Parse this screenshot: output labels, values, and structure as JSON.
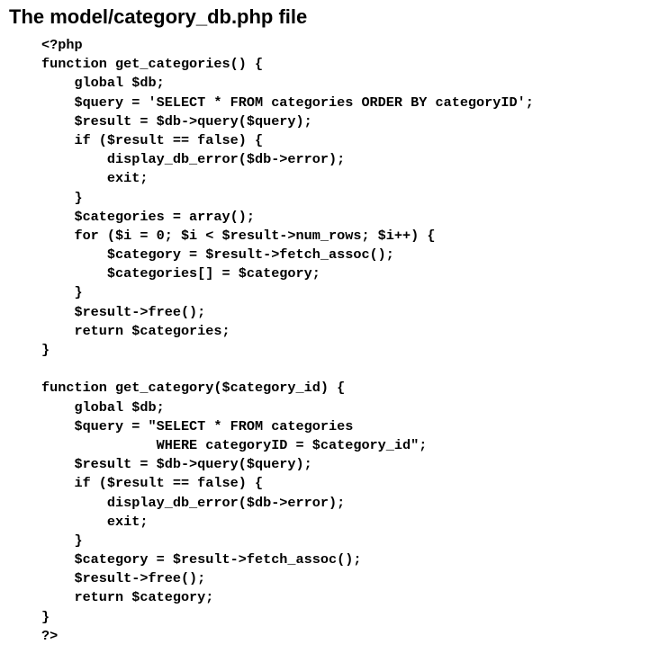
{
  "document": {
    "title": "The model/category_db.php file",
    "code_lines": [
      "<?php",
      "function get_categories() {",
      "    global $db;",
      "    $query = 'SELECT * FROM categories ORDER BY categoryID';",
      "    $result = $db->query($query);",
      "    if ($result == false) {",
      "        display_db_error($db->error);",
      "        exit;",
      "    }",
      "    $categories = array();",
      "    for ($i = 0; $i < $result->num_rows; $i++) {",
      "        $category = $result->fetch_assoc();",
      "        $categories[] = $category;",
      "    }",
      "    $result->free();",
      "    return $categories;",
      "}",
      "",
      "function get_category($category_id) {",
      "    global $db;",
      "    $query = \"SELECT * FROM categories",
      "              WHERE categoryID = $category_id\";",
      "    $result = $db->query($query);",
      "    if ($result == false) {",
      "        display_db_error($db->error);",
      "        exit;",
      "    }",
      "    $category = $result->fetch_assoc();",
      "    $result->free();",
      "    return $category;",
      "}",
      "?>"
    ]
  }
}
